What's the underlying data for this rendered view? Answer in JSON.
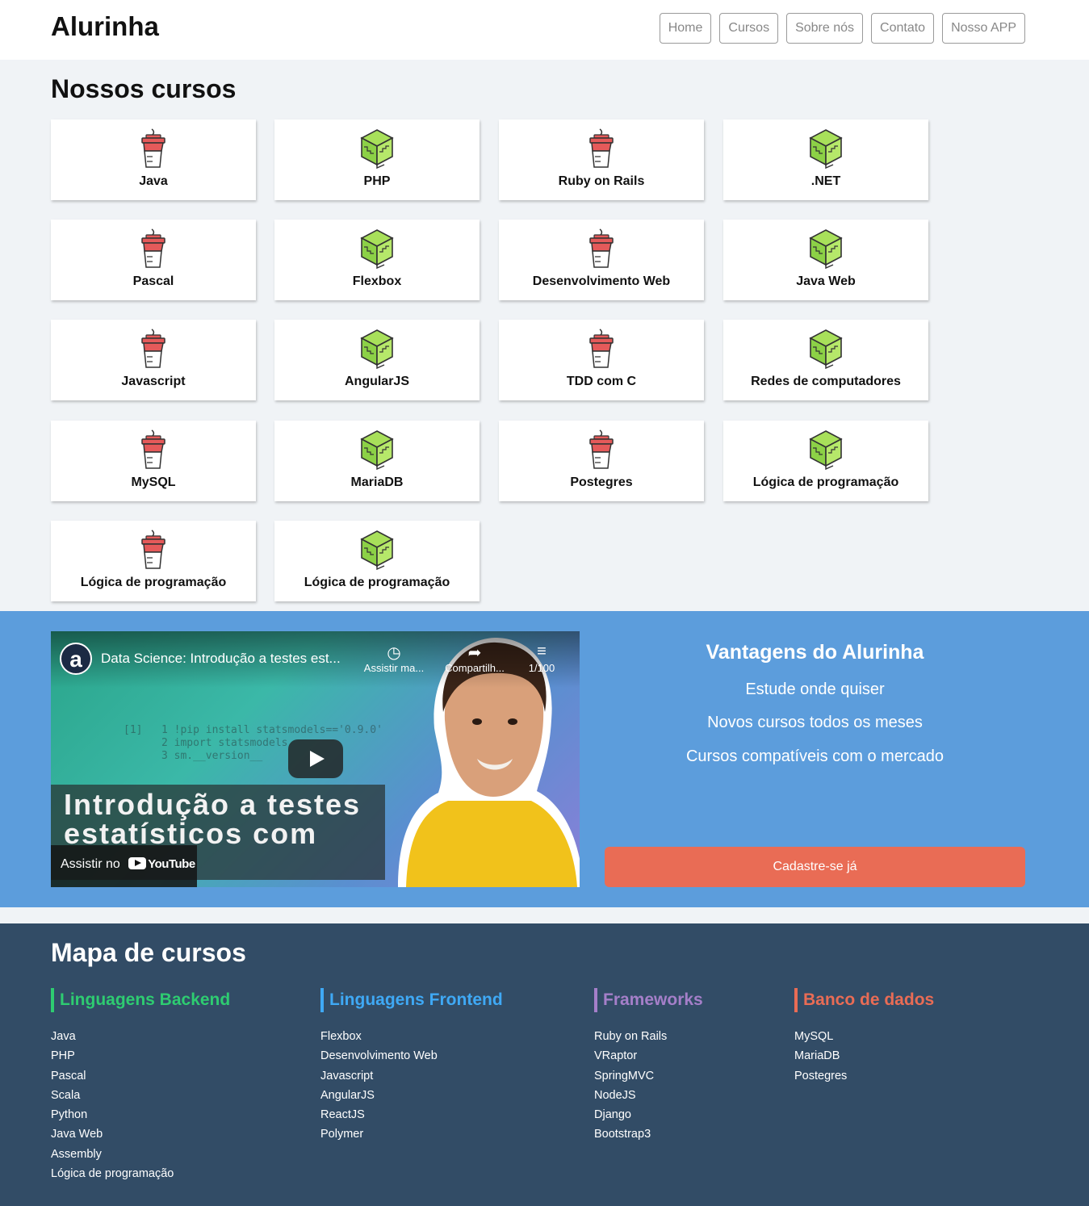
{
  "header": {
    "logo": "Alurinha",
    "nav": [
      "Home",
      "Cursos",
      "Sobre nós",
      "Contato",
      "Nosso APP"
    ]
  },
  "courses": {
    "title": "Nossos cursos",
    "items": [
      {
        "label": "Java",
        "icon": "cup-icon"
      },
      {
        "label": "PHP",
        "icon": "cube-icon"
      },
      {
        "label": "Ruby on Rails",
        "icon": "cup-icon"
      },
      {
        "label": ".NET",
        "icon": "cube-icon"
      },
      {
        "label": "Pascal",
        "icon": "cup-icon"
      },
      {
        "label": "Flexbox",
        "icon": "cube-icon"
      },
      {
        "label": "Desenvolvimento Web",
        "icon": "cup-icon"
      },
      {
        "label": "Java Web",
        "icon": "cube-icon"
      },
      {
        "label": "Javascript",
        "icon": "cup-icon"
      },
      {
        "label": "AngularJS",
        "icon": "cube-icon"
      },
      {
        "label": "TDD com C",
        "icon": "cup-icon"
      },
      {
        "label": "Redes de computadores",
        "icon": "cube-icon"
      },
      {
        "label": "MySQL",
        "icon": "cup-icon"
      },
      {
        "label": "MariaDB",
        "icon": "cube-icon"
      },
      {
        "label": "Postegres",
        "icon": "cup-icon"
      },
      {
        "label": "Lógica de programação",
        "icon": "cube-icon"
      },
      {
        "label": "Lógica de programação",
        "icon": "cup-icon"
      },
      {
        "label": "Lógica de programação",
        "icon": "cube-icon"
      }
    ]
  },
  "video": {
    "channel_initial": "a",
    "title": "Data Science: Introdução a testes est...",
    "watch_later": "Assistir ma...",
    "share": "Compartilh...",
    "playlist": "1/100",
    "overlay_line1": "Introdução a testes",
    "overlay_line2": "estatísticos com",
    "watch_on": "Assistir no",
    "youtube": "YouTube",
    "code_text": "[1]   1 !pip install statsmodels=='0.9.0'\n      2 import statsmodels\n      3 sm.__version__"
  },
  "advantages": {
    "title": "Vantagens do Alurinha",
    "items": [
      "Estude onde quiser",
      "Novos cursos todos os meses",
      "Cursos compatíveis com o mercado"
    ],
    "cta": "Cadastre-se já"
  },
  "map": {
    "title": "Mapa de cursos",
    "columns": [
      {
        "heading": "Linguagens Backend",
        "color": "#2ecc71",
        "links": [
          "Java",
          "PHP",
          "Pascal",
          "Scala",
          "Python",
          "Java Web",
          "Assembly",
          "Lógica de programação"
        ]
      },
      {
        "heading": "Linguagens Frontend",
        "color": "#3fa9f5",
        "links": [
          "Flexbox",
          "Desenvolvimento Web",
          "Javascript",
          "AngularJS",
          "ReactJS",
          "Polymer"
        ]
      },
      {
        "heading": "Frameworks",
        "color": "#a57fc9",
        "links": [
          "Ruby on Rails",
          "VRaptor",
          "SpringMVC",
          "NodeJS",
          "Django",
          "Bootstrap3"
        ]
      },
      {
        "heading": "Banco de dados",
        "color": "#e96c55",
        "links": [
          "MySQL",
          "MariaDB",
          "Postegres"
        ]
      }
    ]
  },
  "colors": {
    "band": "#5c9ddc",
    "footer": "#324c66",
    "cta": "#e96c55"
  }
}
